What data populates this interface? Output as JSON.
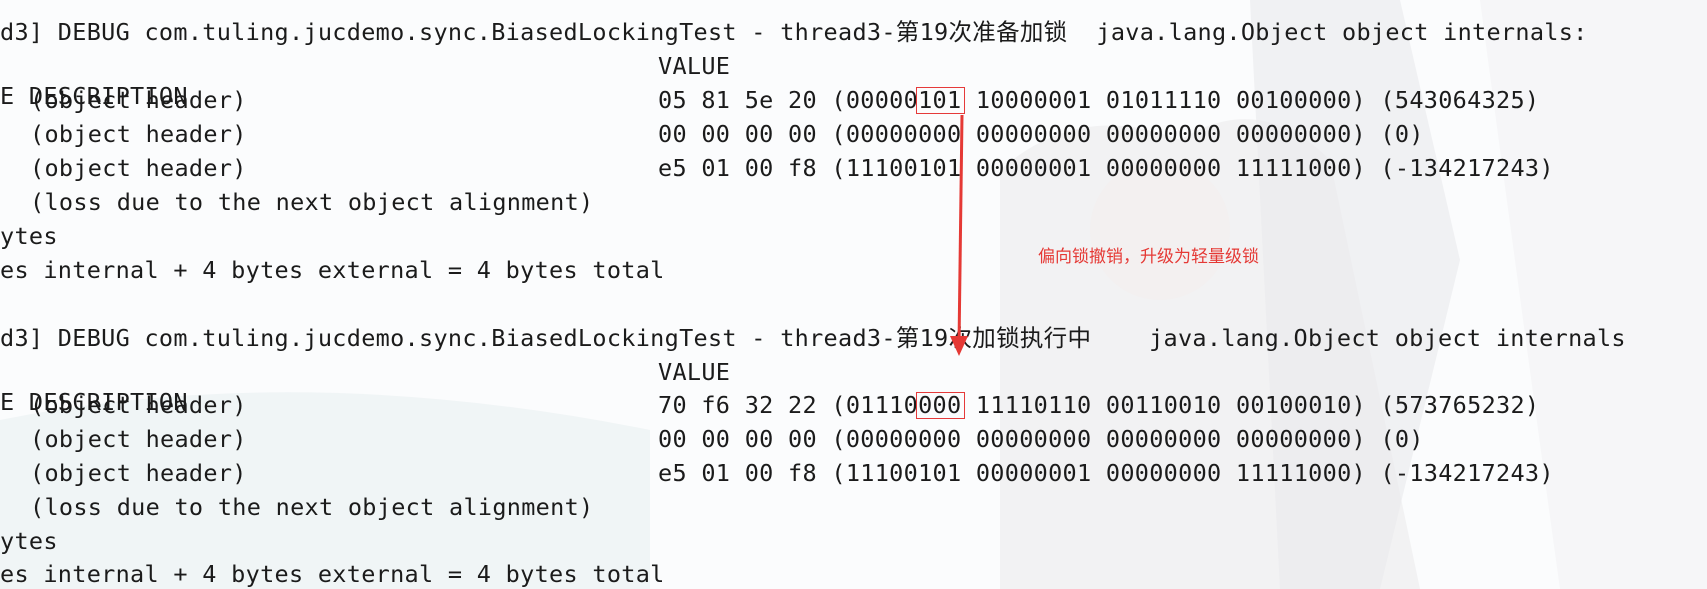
{
  "block1": {
    "header": "d3] DEBUG com.tuling.jucdemo.sync.BiasedLockingTest - thread3-第19次准备加锁  java.lang.Object object internals:",
    "desc_header": "E DESCRIPTION",
    "value_header": "VALUE",
    "row1": {
      "desc": "(object header)",
      "pre": "05 81 5e 20 (00000",
      "hl": "101",
      "post": " 10000001 01011110 00100000) (543064325)"
    },
    "row2": {
      "desc": "(object header)",
      "value": "00 00 00 00 (00000000 00000000 00000000 00000000) (0)"
    },
    "row3": {
      "desc": "(object header)",
      "value": "e5 01 00 f8 (11100101 00000001 00000000 11111000) (-134217243)"
    },
    "loss": "(loss due to the next object alignment)",
    "bytes": "ytes",
    "summary": "es internal + 4 bytes external = 4 bytes total"
  },
  "block2": {
    "header": "d3] DEBUG com.tuling.jucdemo.sync.BiasedLockingTest - thread3-第19次加锁执行中    java.lang.Object object internals",
    "desc_header": "E DESCRIPTION",
    "value_header": "VALUE",
    "row1": {
      "desc": "(object header)",
      "pre": "70 f6 32 22 (01110",
      "hl": "000",
      "post": " 11110110 00110010 00100010) (573765232)"
    },
    "row2": {
      "desc": "(object header)",
      "value": "00 00 00 00 (00000000 00000000 00000000 00000000) (0)"
    },
    "row3": {
      "desc": "(object header)",
      "value": "e5 01 00 f8 (11100101 00000001 00000000 11111000) (-134217243)"
    },
    "loss": "(loss due to the next object alignment)",
    "bytes": "ytes",
    "summary": "es internal + 4 bytes external = 4 bytes total"
  },
  "annotation": "偏向锁撤销，升级为轻量级锁",
  "colors": {
    "annotation": "#e53935",
    "highlight_box": "#e53a3a",
    "arrow": "#e53935",
    "text": "#1b1b1b"
  }
}
